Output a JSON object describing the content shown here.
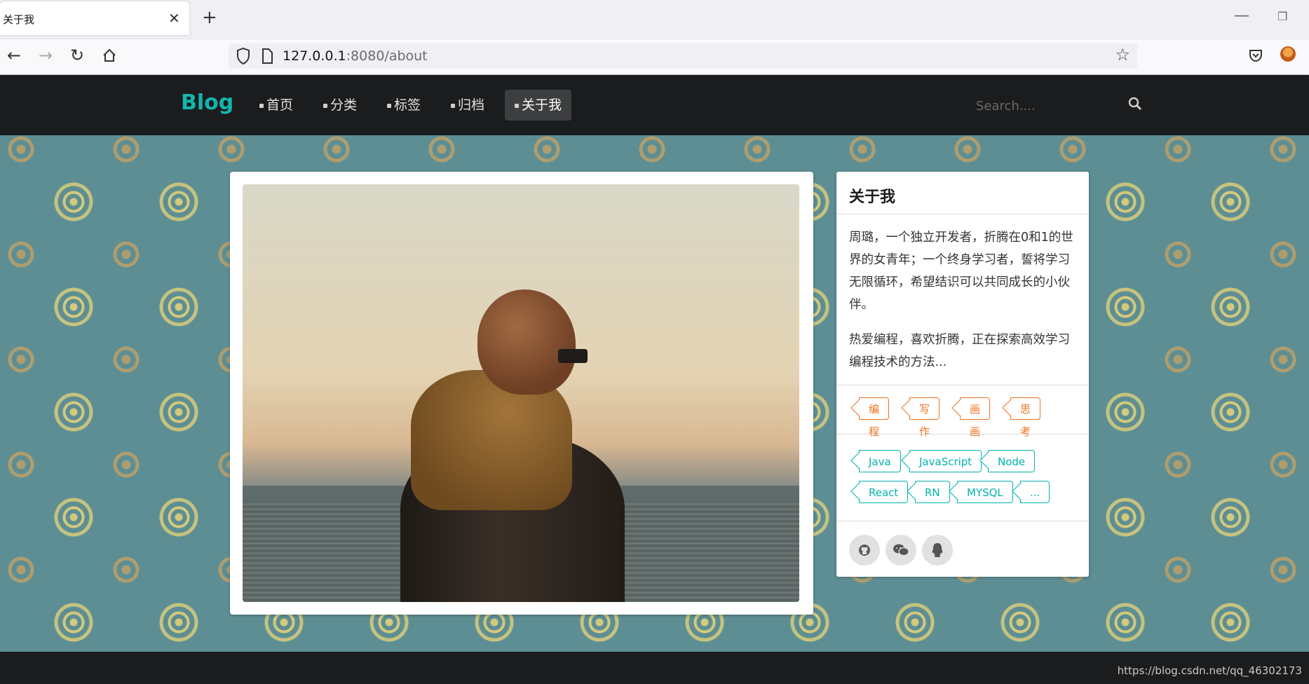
{
  "browser": {
    "tab_title": "关于我",
    "url_host": "127.0.0.1",
    "url_path": ":8080/about"
  },
  "site": {
    "brand": "Blog",
    "menu": [
      {
        "label": "首页"
      },
      {
        "label": "分类"
      },
      {
        "label": "标签"
      },
      {
        "label": "归档"
      },
      {
        "label": "关于我",
        "active": true
      }
    ],
    "search_placeholder": "Search...."
  },
  "about": {
    "title": "关于我",
    "bio": [
      "周璐，一个独立开发者，折腾在0和1的世界的女青年；一个终身学习者，誓将学习无限循环，希望结识可以共同成长的小伙伴。",
      "热爱编程，喜欢折腾，正在探索高效学习编程技术的方法..."
    ],
    "categories": [
      "编程",
      "写作",
      "画画",
      "思考"
    ],
    "tags": [
      "Java",
      "JavaScript",
      "Node",
      "React",
      "RN",
      "MYSQL",
      "..."
    ],
    "social": [
      "github-icon",
      "wechat-icon",
      "qq-icon"
    ]
  },
  "colors": {
    "brand": "#14b5ad",
    "category_tag": "#f2711c",
    "tech_tag": "#00b5ad",
    "header_bg": "#1b1c1d"
  },
  "watermark": "https://blog.csdn.net/qq_46302173"
}
